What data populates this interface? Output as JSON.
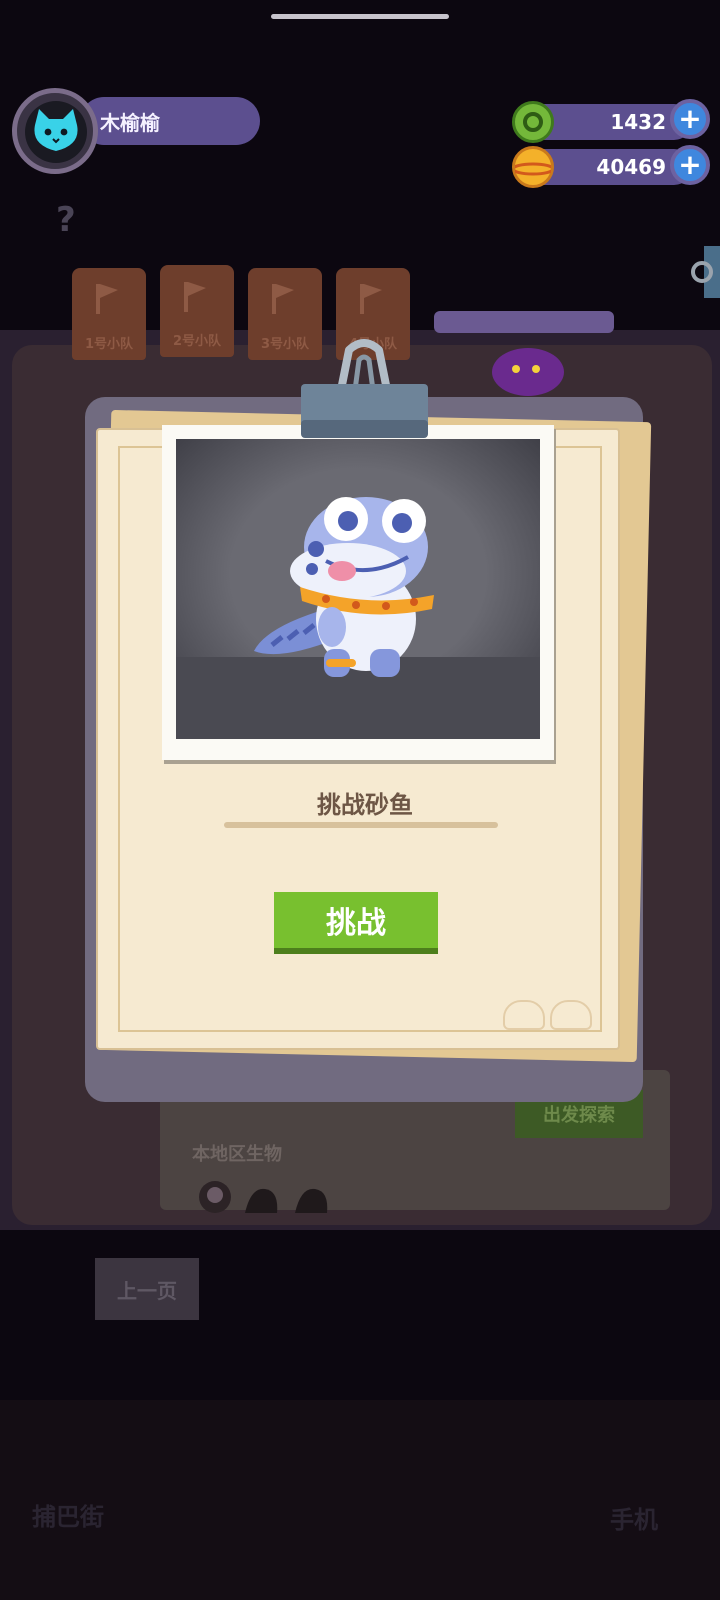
{
  "header": {
    "player_name": "木榆榆",
    "currencies": [
      {
        "icon": "green-gem-coin-icon",
        "value": "1432",
        "color": "#74b83a"
      },
      {
        "icon": "gold-planet-coin-icon",
        "value": "40469",
        "color": "#f4b12a"
      }
    ],
    "hint": "?"
  },
  "background": {
    "squads": [
      "1号小队",
      "2号小队",
      "3号小队",
      "4号小队"
    ],
    "depart_label": "出发探索",
    "local_creatures_label": "本地区生物",
    "prev_page_label": "上一页",
    "bottom_left_label": "捕巴街",
    "bottom_right_label": "手机"
  },
  "modal": {
    "title": "挑战砂鱼",
    "challenge_label": "挑战",
    "accent": "#78c02f",
    "creature": "sand-fish-lizard"
  }
}
